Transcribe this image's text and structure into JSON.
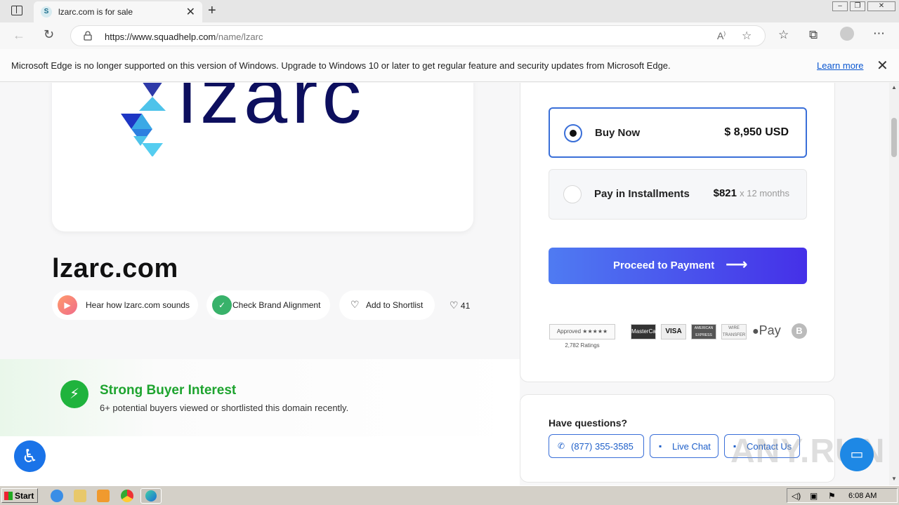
{
  "browser": {
    "tab_title": "lzarc.com is for sale",
    "tab_favicon": "S",
    "url_host": "https://www.squadhelp.com",
    "url_path": "/name/lzarc",
    "new_tab_symbol": "+",
    "close_symbol": "✕"
  },
  "notice": {
    "message": "Microsoft Edge is no longer supported on this version of Windows. Upgrade to Windows 10 or later to get regular feature and security updates from Microsoft Edge.",
    "learn_more": "Learn more"
  },
  "listing": {
    "logo_text": "lzarc",
    "domain": "lzarc.com",
    "actions": {
      "hear": "Hear how lzarc.com sounds",
      "brand": "Check Brand Alignment",
      "shortlist": "Add to Shortlist",
      "likes": "41"
    },
    "interest": {
      "heading": "Strong Buyer Interest",
      "subtext": "6+ potential buyers viewed or shortlisted this domain recently."
    }
  },
  "purchase": {
    "buy_now_label": "Buy Now",
    "buy_now_price": "$ 8,950 USD",
    "installments_label": "Pay in Installments",
    "installments_price": "$821",
    "installments_term": "x 12 months",
    "proceed_label": "Proceed to Payment",
    "payment_logos": {
      "trust": "Approved ★★★★★ 2,782 Ratings",
      "mastercard": "MasterCard",
      "visa": "VISA",
      "amex": "AMERICAN EXPRESS",
      "wire": "WIRE TRANSFER",
      "applepay": "Pay",
      "bitcoin": "B"
    }
  },
  "questions": {
    "heading": "Have questions?",
    "phone": "(877) 355-3585",
    "live_chat": "Live Chat",
    "contact": "Contact Us"
  },
  "taskbar": {
    "start": "Start",
    "clock": "6:08 AM"
  },
  "colors": {
    "primary_blue": "#3a6fd8",
    "logo_navy": "#0d0f5e",
    "success_green": "#1ea42f"
  }
}
